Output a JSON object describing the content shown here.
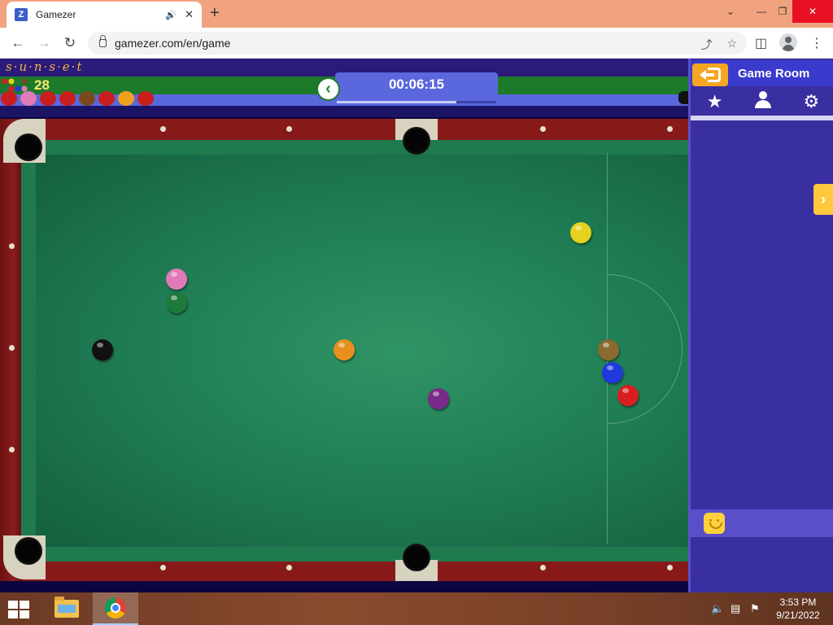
{
  "browser": {
    "tab_title": "Gamezer",
    "favicon_letter": "Z",
    "url": "gamezer.com/en/game",
    "icons": [
      "audio-icon",
      "close-icon",
      "new-tab-icon",
      "minimize-icon",
      "restore-icon",
      "window-close-icon",
      "back-icon",
      "forward-icon",
      "reload-icon",
      "lock-icon",
      "share-icon",
      "bookmark-star-icon",
      "side-panel-icon",
      "profile-icon",
      "menu-icon"
    ]
  },
  "game": {
    "logo": "s·u·n·s·e·t",
    "score": "28",
    "timer": "00:06:15",
    "timer_progress": 0.75,
    "potted_balls": [
      "#c81e1e",
      "#e07bb8",
      "#c81e1e",
      "#c81e1e",
      "#7a4a1e",
      "#c81e1e",
      "#f0a01e",
      "#c81e1e"
    ],
    "table_balls": [
      {
        "color": "#e6d21e",
        "name": "yellow"
      },
      {
        "color": "#e07bb8",
        "name": "pink"
      },
      {
        "color": "#1e7a3a",
        "name": "green"
      },
      {
        "color": "#111111",
        "name": "black"
      },
      {
        "color": "#e8901e",
        "name": "orange"
      },
      {
        "color": "#8a6a2e",
        "name": "brown"
      },
      {
        "color": "#1e3adc",
        "name": "blue"
      },
      {
        "color": "#d81e1e",
        "name": "red"
      },
      {
        "color": "#7a2a8a",
        "name": "purple"
      }
    ],
    "colors": {
      "felt": "#1e7a52",
      "rail": "#7a1616",
      "hud": "#5a67dd"
    }
  },
  "panel": {
    "title": "Game Room",
    "tabs": [
      "star-icon",
      "user-icon",
      "gear-icon"
    ]
  },
  "taskbar": {
    "time": "3:53 PM",
    "date": "9/21/2022"
  }
}
